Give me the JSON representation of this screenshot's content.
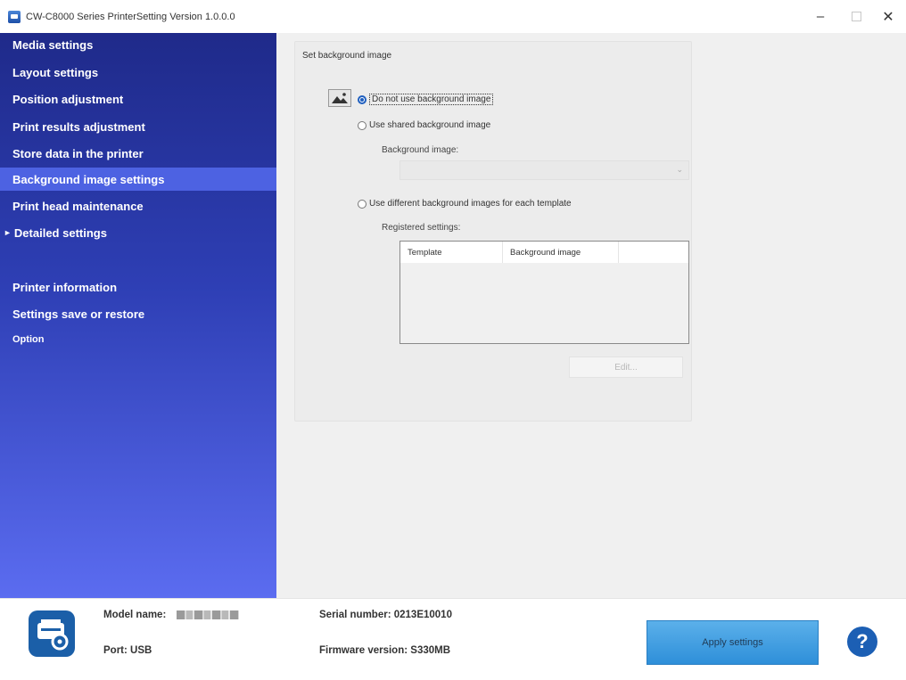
{
  "window": {
    "title": "CW-C8000 Series PrinterSetting Version 1.0.0.0",
    "minimize": "–",
    "close": "✕"
  },
  "sidebar": {
    "items": [
      {
        "label": "Media settings"
      },
      {
        "label": "Layout settings"
      },
      {
        "label": "Position adjustment"
      },
      {
        "label": "Print results adjustment"
      },
      {
        "label": "Store data in the printer"
      },
      {
        "label": "Background image settings",
        "active": true
      },
      {
        "label": "Print head maintenance"
      },
      {
        "label": "Detailed settings",
        "expandable": true
      },
      {
        "label": "Printer information"
      },
      {
        "label": "Settings save or restore"
      },
      {
        "label": "Option"
      }
    ],
    "expand_arrow": "►"
  },
  "background": {
    "group_title": "Set background image",
    "options": [
      {
        "label": "Do not use background image",
        "checked": true
      },
      {
        "label": "Use shared background image",
        "checked": false
      },
      {
        "label": "Use different background images for each template",
        "checked": false
      }
    ],
    "background_image_label": "Background image:",
    "background_image_value": "",
    "combo_arrow": "⌄",
    "registered_settings_label": "Registered settings:",
    "table_columns": [
      "Template",
      "Background image"
    ],
    "table_rows": [],
    "edit_button": "Edit..."
  },
  "footer": {
    "model_name_label": "Model name:",
    "port_label": "Port:",
    "port_value": "USB",
    "serial_label": "Serial number:",
    "serial_value": "0213E10010",
    "firmware_label": "Firmware version:",
    "firmware_value": "S330MB",
    "apply_button": "Apply settings",
    "help_button": "?"
  },
  "colors": {
    "sidebar_top": "#1f2a8a",
    "sidebar_bottom": "#5b6cf0",
    "active_item": "#4d62e2",
    "apply_button": "#3d9de0",
    "help_button": "#1c5fb4"
  },
  "icons": [
    "app-icon",
    "image-icon",
    "printer-settings-icon",
    "help-icon",
    "chevron-down-icon"
  ]
}
